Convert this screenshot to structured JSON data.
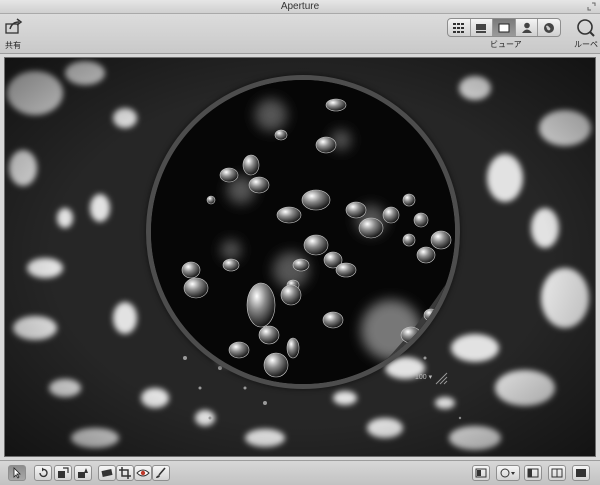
{
  "window": {
    "title": "Aperture"
  },
  "toolbar": {
    "share_label": "共有",
    "view_label": "ビューア",
    "loupe_label": "ルーペ",
    "view_modes": [
      {
        "icon": "grid-view-icon",
        "active": false
      },
      {
        "icon": "filmstrip-view-icon",
        "active": false
      },
      {
        "icon": "viewer-mode-icon",
        "active": true
      },
      {
        "icon": "faces-icon",
        "active": false
      },
      {
        "icon": "places-globe-icon",
        "active": false
      }
    ]
  },
  "loupe": {
    "zoom": "100 ▾"
  },
  "bottom_tools": [
    "selection-tool-icon",
    "rotate-tool-icon",
    "lift-tool-icon",
    "stamp-tool-icon",
    "straighten-tool-icon",
    "crop-tool-icon",
    "red-eye-tool-icon",
    "brush-tool-icon",
    "browser-icon",
    "aperture-menu-icon",
    "inspector-icon",
    "dual-display-icon",
    "fullscreen-mode-icon"
  ]
}
